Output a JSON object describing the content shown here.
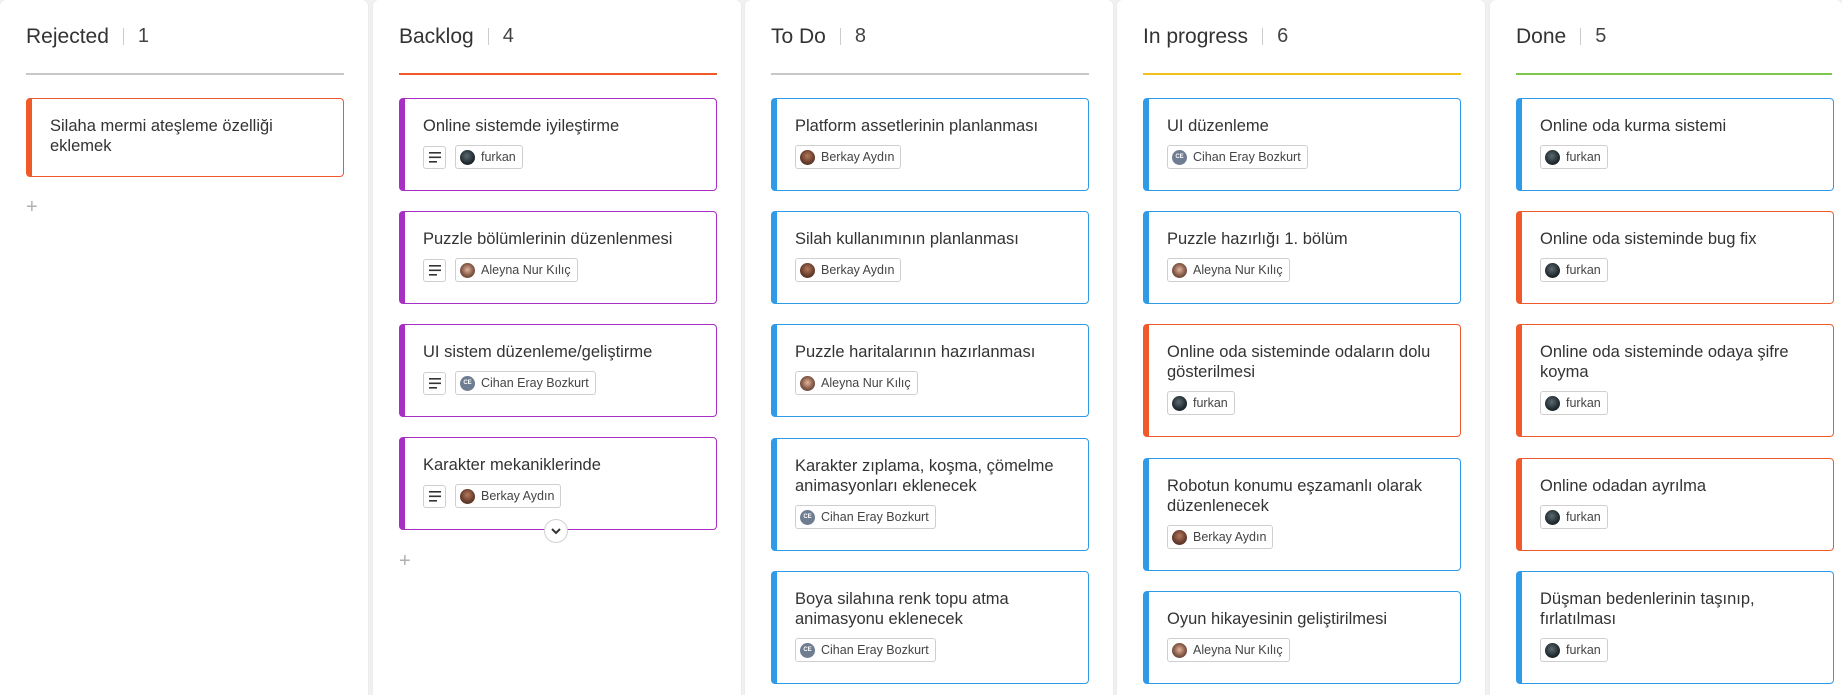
{
  "columns": [
    {
      "title": "Rejected",
      "count": "1",
      "accent": "#c8c8c8",
      "cards": [
        {
          "title": "Silaha mermi ateşleme özelliği eklemek",
          "color": "#f05a2b"
        }
      ]
    },
    {
      "title": "Backlog",
      "count": "4",
      "accent": "#f05a2b",
      "cards": [
        {
          "title": "Online sistemde iyileştirme",
          "assignee": "furkan",
          "color": "#a72fc4"
        },
        {
          "title": "Puzzle bölümlerinin düzenlenmesi",
          "assignee": "Aleyna Nur Kılıç",
          "color": "#a72fc4"
        },
        {
          "title": "UI sistem düzenleme/geliştirme",
          "assignee": "Cihan Eray Bozkurt",
          "color": "#a72fc4"
        },
        {
          "title": "Karakter mekaniklerinde",
          "assignee": "Berkay Aydın",
          "color": "#a72fc4"
        }
      ]
    },
    {
      "title": "To Do",
      "count": "8",
      "accent": "#c8c8c8",
      "cards": [
        {
          "title": "Platform assetlerinin planlanması",
          "assignee": "Berkay Aydın",
          "color": "#2f9be8"
        },
        {
          "title": "Silah kullanımının planlanması",
          "assignee": "Berkay Aydın",
          "color": "#2f9be8"
        },
        {
          "title": "Puzzle haritalarının hazırlanması",
          "assignee": "Aleyna Nur Kılıç",
          "color": "#2f9be8"
        },
        {
          "title": "Karakter zıplama, koşma, çömelme animasyonları eklenecek",
          "assignee": "Cihan Eray Bozkurt",
          "color": "#2f9be8"
        },
        {
          "title": "Boya silahına renk topu atma animasyonu eklenecek",
          "assignee": "Cihan Eray Bozkurt",
          "color": "#2f9be8"
        }
      ]
    },
    {
      "title": "In progress",
      "count": "6",
      "accent": "#f2c21b",
      "cards": [
        {
          "title": "UI düzenleme",
          "assignee": "Cihan Eray Bozkurt",
          "color": "#2f9be8"
        },
        {
          "title": "Puzzle hazırlığı 1. bölüm",
          "assignee": "Aleyna Nur Kılıç",
          "color": "#2f9be8"
        },
        {
          "title": "Online oda sisteminde odaların dolu gösterilmesi",
          "assignee": "furkan",
          "color": "#f05a2b"
        },
        {
          "title": "Robotun konumu eşzamanlı olarak düzenlenecek",
          "assignee": "Berkay Aydın",
          "color": "#2f9be8"
        },
        {
          "title": "Oyun hikayesinin geliştirilmesi",
          "assignee": "Aleyna Nur Kılıç",
          "color": "#2f9be8"
        }
      ]
    },
    {
      "title": "Done",
      "count": "5",
      "accent": "#7bc74d",
      "cards": [
        {
          "title": "Online oda kurma sistemi",
          "assignee": "furkan",
          "color": "#2f9be8"
        },
        {
          "title": "Online oda sisteminde bug fix",
          "assignee": "furkan",
          "color": "#f05a2b"
        },
        {
          "title": "Online oda sisteminde odaya şifre koyma",
          "assignee": "furkan",
          "color": "#f05a2b"
        },
        {
          "title": "Online odadan ayrılma",
          "assignee": "furkan",
          "color": "#f05a2b"
        },
        {
          "title": "Düşman bedenlerinin taşınıp, fırlatılması",
          "assignee": "furkan",
          "color": "#2f9be8"
        }
      ]
    }
  ],
  "icons": {
    "add": "plus-icon",
    "description": "description-icon",
    "expand": "chevron-down-icon"
  },
  "add_symbol": "+"
}
